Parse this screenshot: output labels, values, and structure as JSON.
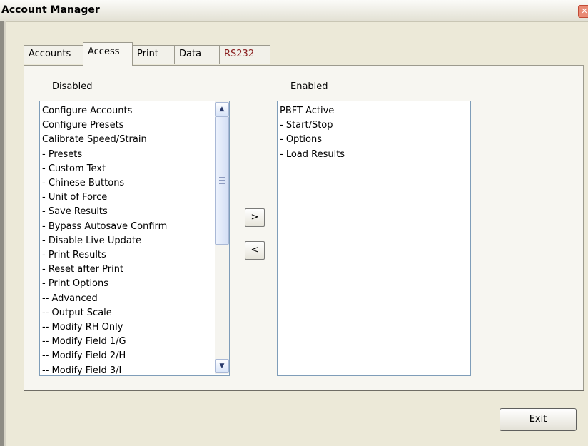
{
  "window": {
    "title": "Account Manager",
    "close_glyph": "✕"
  },
  "tabs": [
    {
      "label": "Accounts"
    },
    {
      "label": "Access",
      "active": true
    },
    {
      "label": "Print"
    },
    {
      "label": "Data"
    },
    {
      "label": "RS232"
    }
  ],
  "disabled": {
    "label": "Disabled",
    "items": [
      "Configure Accounts",
      "Configure Presets",
      "Calibrate Speed/Strain",
      "- Presets",
      "- Custom Text",
      "- Chinese Buttons",
      "- Unit of Force",
      "- Save Results",
      "- Bypass Autosave Confirm",
      "- Disable Live Update",
      "- Print Results",
      "- Reset after Print",
      "- Print Options",
      "-- Advanced",
      "-- Output Scale",
      "-- Modify RH Only",
      "-- Modify Field 1/G",
      "-- Modify Field 2/H",
      "-- Modify Field 3/I"
    ],
    "scroll_up_glyph": "▲",
    "scroll_down_glyph": "▼"
  },
  "enabled": {
    "label": "Enabled",
    "items": [
      "PBFT Active",
      "- Start/Stop",
      "- Options",
      "- Load Results"
    ]
  },
  "buttons": {
    "add": ">",
    "remove": "<",
    "exit": "Exit"
  },
  "colors": {
    "window_bg": "#ece9d8",
    "rs232_tab_text": "#8a1e1e"
  }
}
